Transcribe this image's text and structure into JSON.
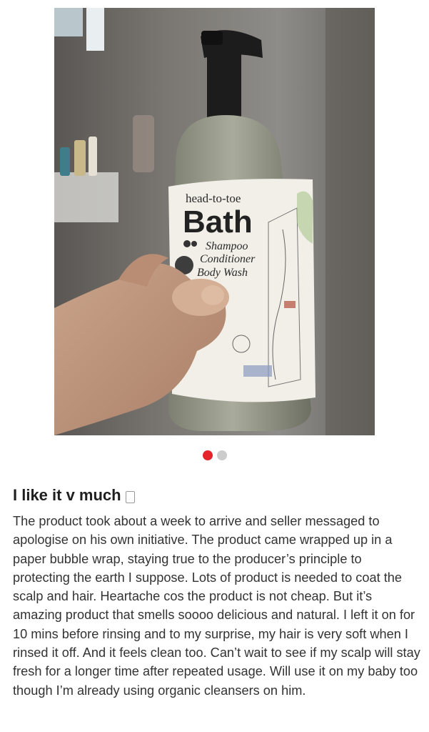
{
  "photo": {
    "label": {
      "line1": "head-to-toe",
      "brand": "Bath",
      "uses": [
        "Shampoo",
        "Conditioner",
        "Body Wash"
      ]
    }
  },
  "gallery": {
    "count": 2,
    "active_index": 0,
    "active_color": "#e4232b",
    "inactive_color": "#cccccc"
  },
  "review": {
    "title": "I like it v much",
    "body": "The product took about a week to arrive and seller messaged to apologise on his own initiative. The product came wrapped up in a paper bubble wrap, staying true to the producer’s principle to protecting the earth I suppose. Lots of product is needed to coat the scalp and hair. Heartache cos the product is not cheap. But it’s amazing product that smells soooo delicious and natural. I left it on for 10 mins before rinsing and to my surprise, my hair is very soft when I rinsed it off. And it feels clean too. Can’t wait to see if my scalp will stay fresh for a longer time after repeated usage. Will use it on my baby too though I’m already using organic cleansers on him."
  }
}
